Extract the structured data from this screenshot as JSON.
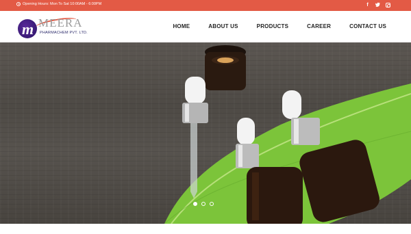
{
  "topbar": {
    "opening_hours": "Opening Hours: Mon To Sat 10:00AM - 6:00PM",
    "social": [
      {
        "name": "facebook-icon",
        "glyph": "f"
      },
      {
        "name": "twitter-icon",
        "glyph": "t"
      },
      {
        "name": "instagram-icon",
        "glyph": ""
      }
    ],
    "background": "#e35a45"
  },
  "header": {
    "logo": {
      "brand": "MEERA",
      "subtitle": "PHARMACHEM PVT. LTD."
    },
    "nav": [
      "HOME",
      "ABOUT US",
      "PRODUCTS",
      "CAREER",
      "CONTACT US"
    ]
  },
  "hero": {
    "slides_total": 3,
    "active_slide": 1
  }
}
